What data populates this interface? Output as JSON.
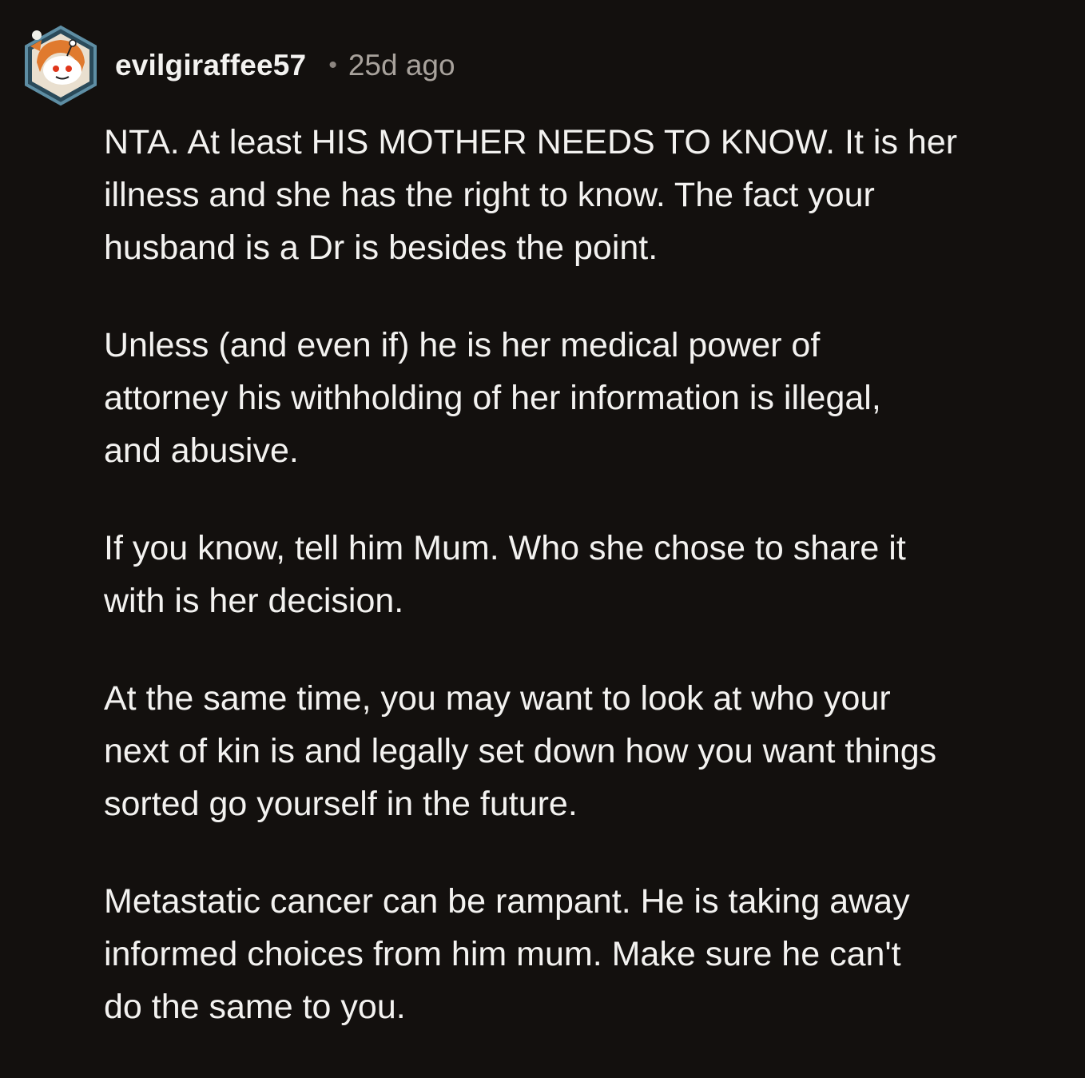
{
  "comment": {
    "author": "evilgiraffee57",
    "separator": "•",
    "timestamp": "25d ago",
    "avatar_icon": "snoo-avatar-icon",
    "paragraphs": [
      "NTA. At least HIS MOTHER NEEDS TO KNOW. It is her\nillness and she has the right to know. The fact your\nhusband is a Dr is besides the point.",
      "Unless (and even if) he is her medical power of\nattorney his withholding of her information is illegal,\nand abusive.",
      "If you know, tell him Mum. Who she chose to share it\nwith is her decision.",
      "At the same time, you may want to look at who your\nnext of kin is and legally set down how you want things\nsorted go yourself in the future.",
      "Metastatic cancer can be rampant. He is taking away\ninformed choices from him mum. Make sure he can't\ndo the same to you."
    ]
  },
  "colors": {
    "background": "#13100e",
    "text": "#f3f2f0",
    "meta": "#a8a29c",
    "avatar_ring": "#2f5a6e"
  }
}
